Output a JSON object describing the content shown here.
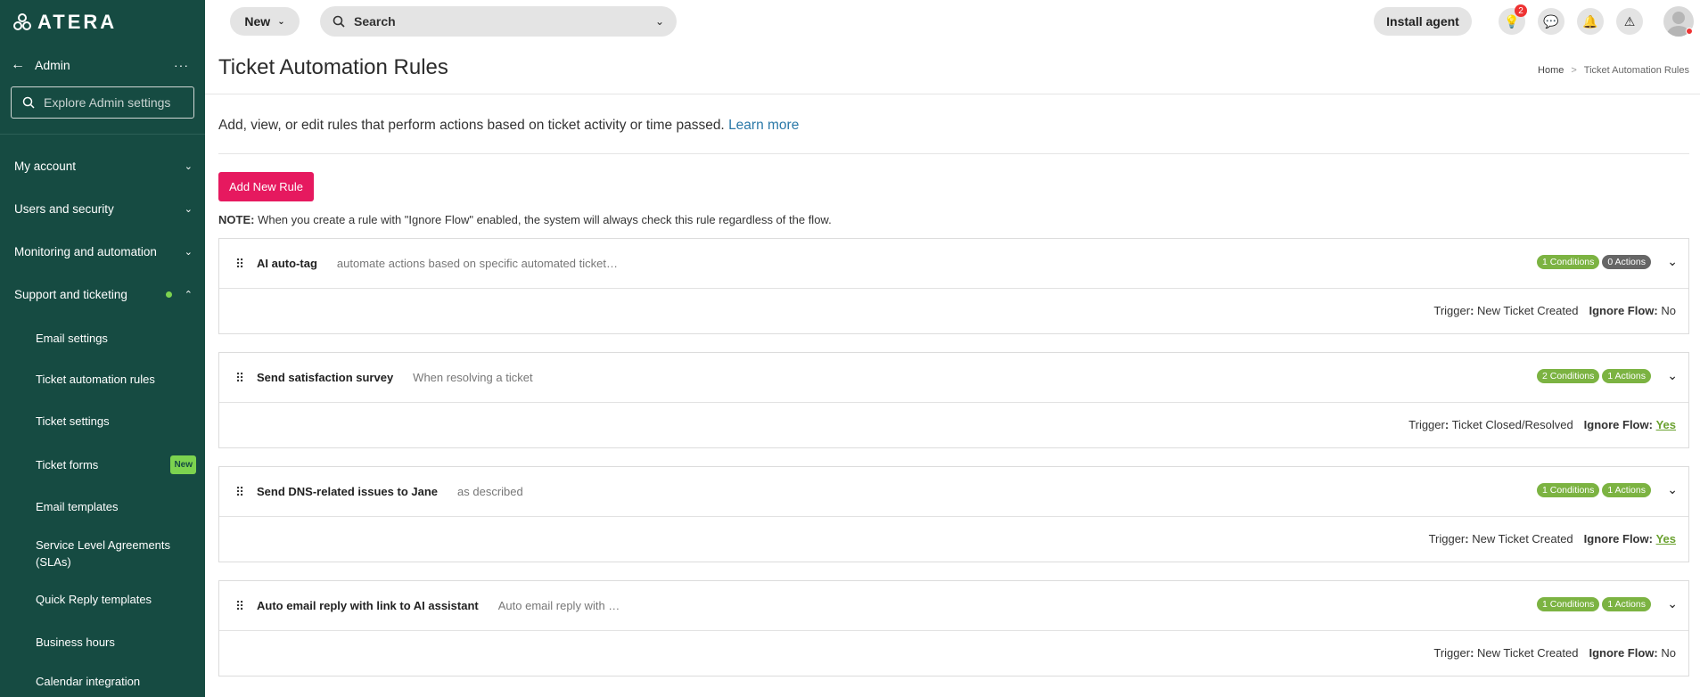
{
  "brand": {
    "logo_text": "ATERA",
    "accent": "#e6195f",
    "sidebar_bg": "#164b42"
  },
  "sidebar": {
    "title": "Admin",
    "search_placeholder": "Explore Admin settings",
    "sections": [
      {
        "label": "My account"
      },
      {
        "label": "Users and security"
      },
      {
        "label": "Monitoring and automation"
      },
      {
        "label": "Support and ticketing"
      }
    ],
    "sub_items": [
      {
        "label": "Email settings"
      },
      {
        "label": "Ticket automation rules"
      },
      {
        "label": "Ticket settings"
      },
      {
        "label": "Ticket forms",
        "badge": "New"
      },
      {
        "label": "Email templates"
      },
      {
        "label": "Service Level Agreements (SLAs)"
      },
      {
        "label": "Quick Reply templates"
      },
      {
        "label": "Business hours"
      },
      {
        "label": "Calendar integration"
      }
    ]
  },
  "topbar": {
    "new_label": "New",
    "search_label": "Search",
    "install_label": "Install agent",
    "notification_count": "2"
  },
  "page": {
    "title": "Ticket Automation Rules",
    "breadcrumb": {
      "home": "Home",
      "current": "Ticket Automation Rules"
    },
    "description": "Add, view, or edit rules that perform actions based on ticket activity or time passed.",
    "learn_more": "Learn more",
    "add_button": "Add New Rule",
    "note_label": "NOTE:",
    "note_text": " When you create a rule with \"Ignore Flow\" enabled, the system will always check this rule regardless of the flow."
  },
  "labels": {
    "trigger": "Trigger",
    "ignore_flow": "Ignore Flow:"
  },
  "rules": [
    {
      "name": "AI auto-tag",
      "description": "automate actions based on specific automated ticket…",
      "conditions": "1 Conditions",
      "actions": "0 Actions",
      "actions_active": false,
      "trigger": "New Ticket Created",
      "ignore_flow": "No"
    },
    {
      "name": "Send satisfaction survey",
      "description": "When resolving a ticket",
      "conditions": "2 Conditions",
      "actions": "1 Actions",
      "actions_active": true,
      "trigger": "Ticket Closed/Resolved",
      "ignore_flow": "Yes"
    },
    {
      "name": "Send DNS-related issues to Jane",
      "description": "as described",
      "conditions": "1 Conditions",
      "actions": "1 Actions",
      "actions_active": true,
      "trigger": "New Ticket Created",
      "ignore_flow": "Yes"
    },
    {
      "name": "Auto email reply with link to AI assistant",
      "description": "Auto email reply with …",
      "conditions": "1 Conditions",
      "actions": "1 Actions",
      "actions_active": true,
      "trigger": "New Ticket Created",
      "ignore_flow": "No"
    }
  ]
}
